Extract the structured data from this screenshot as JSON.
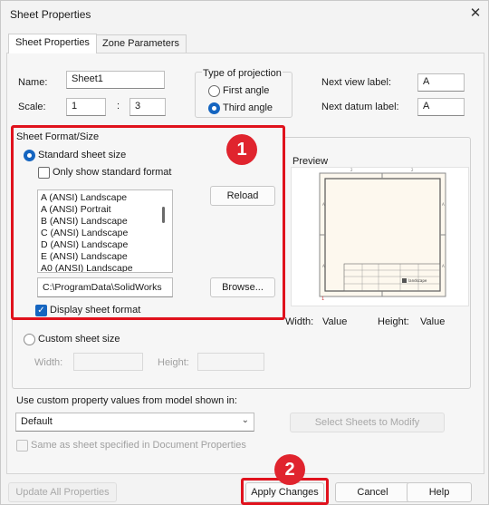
{
  "window": {
    "title": "Sheet Properties"
  },
  "tabs": [
    {
      "label": "Sheet Properties"
    },
    {
      "label": "Zone Parameters"
    }
  ],
  "name": {
    "label": "Name:",
    "value": "Sheet1"
  },
  "scale": {
    "label": "Scale:",
    "value1": "1",
    "separator": ":",
    "value2": "3"
  },
  "projection": {
    "title": "Type of projection",
    "first_angle": "First angle",
    "third_angle": "Third angle",
    "selected": "Third angle"
  },
  "labels": {
    "next_view": "Next view label:",
    "next_view_value": "A",
    "next_datum": "Next datum label:",
    "next_datum_value": "A"
  },
  "format": {
    "title": "Sheet Format/Size",
    "standard_size": "Standard sheet size",
    "only_standard": "Only show standard format",
    "list": [
      "A (ANSI) Landscape",
      "A (ANSI) Portrait",
      "B (ANSI) Landscape",
      "C (ANSI) Landscape",
      "D (ANSI) Landscape",
      "E (ANSI) Landscape",
      "A0 (ANSI) Landscape"
    ],
    "reload": "Reload",
    "path": "C:\\ProgramData\\SolidWorks",
    "browse": "Browse...",
    "display_format": "Display sheet format"
  },
  "preview": {
    "title": "Preview",
    "width_label": "Width:",
    "width_value": "Value",
    "height_label": "Height:",
    "height_value": "Value",
    "title_block_text": "landscape",
    "zone_top": "2",
    "zone_left": "A",
    "zone_right": "A",
    "zone_bottom": "1"
  },
  "custom": {
    "label": "Custom sheet size",
    "width_label": "Width:",
    "height_label": "Height:"
  },
  "property_source": {
    "label": "Use custom property values from model shown in:",
    "value": "Default",
    "select_sheets": "Select Sheets to Modify",
    "same_as": "Same as sheet specified in Document Properties"
  },
  "footer": {
    "update_all": "Update All Properties",
    "apply": "Apply Changes",
    "cancel": "Cancel",
    "help": "Help"
  },
  "badges": {
    "one": "1",
    "two": "2"
  },
  "colors": {
    "accent": "#1565c0",
    "highlight": "#e0121d"
  }
}
